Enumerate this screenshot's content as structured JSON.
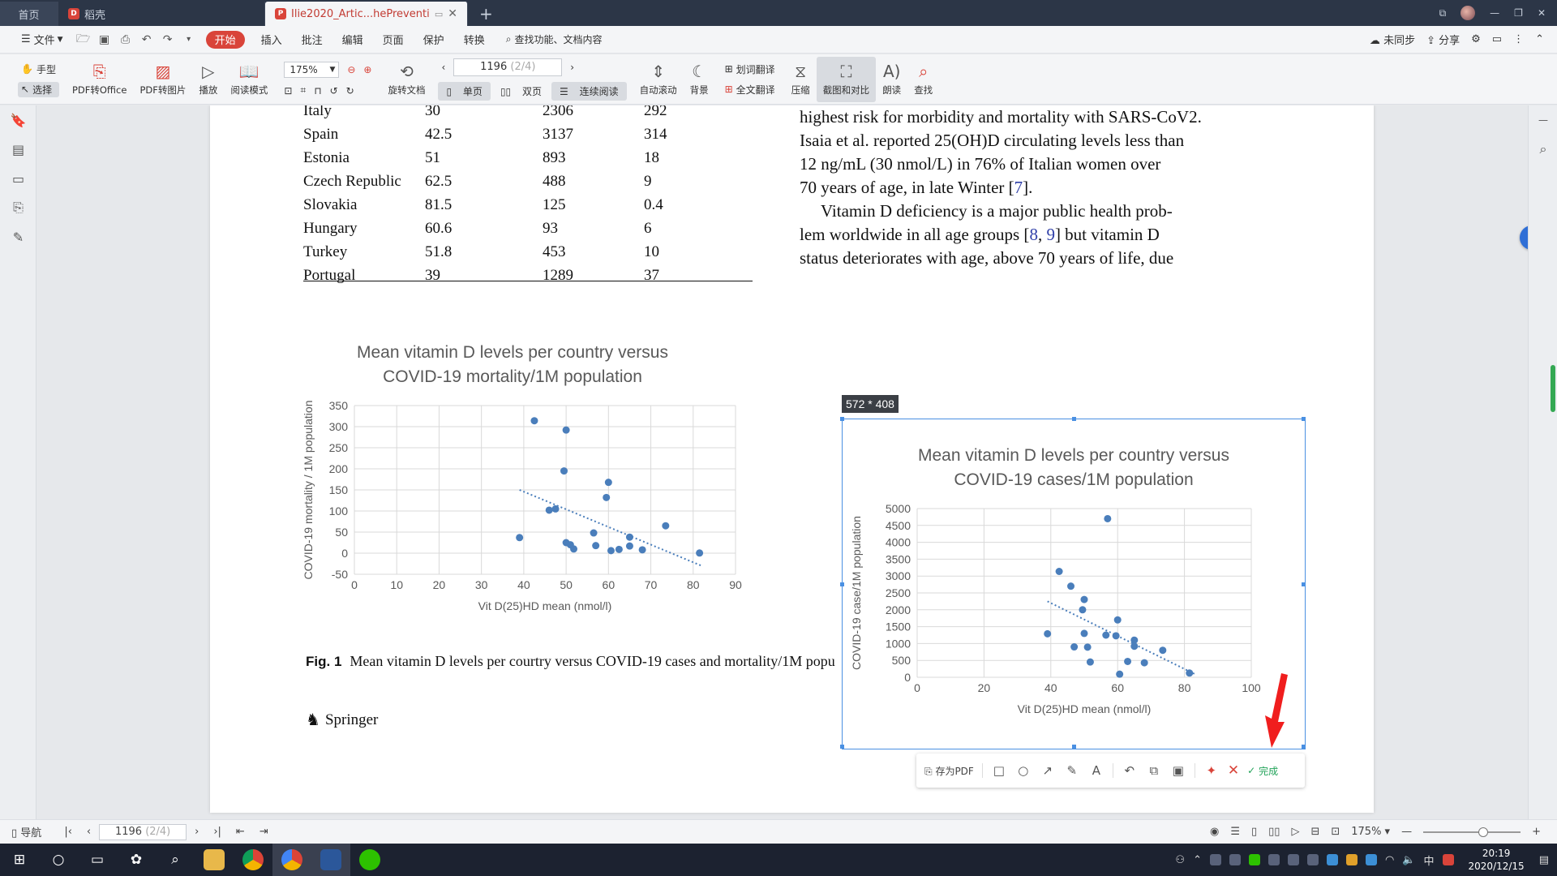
{
  "tabs": {
    "home": "首页",
    "daoke": "稻壳",
    "active": "Ilie2020_Artic...hePreventi.pdf"
  },
  "menu": {
    "file": "文件",
    "start": "开始",
    "items": [
      "插入",
      "批注",
      "编辑",
      "页面",
      "保护",
      "转换"
    ],
    "search": "查找功能、文档内容",
    "sync": "未同步",
    "share": "分享"
  },
  "toolbar": {
    "hand": "手型",
    "select": "选择",
    "pdf_to_office": "PDF转Office",
    "pdf_to_image": "PDF转图片",
    "play": "播放",
    "read_mode": "阅读模式",
    "zoom": "175%",
    "rotate": "旋转文档",
    "page_current": "1196",
    "page_total": "(2/4)",
    "single": "单页",
    "double": "双页",
    "continuous": "连续阅读",
    "autoscroll": "自动滚动",
    "background": "背景",
    "word_translate": "划词翻译",
    "full_translate": "全文翻译",
    "compress": "压缩",
    "screenshot_compare": "截图和对比",
    "read_aloud": "朗读",
    "find": "查找"
  },
  "table_rows": [
    [
      "Italy",
      "30",
      "2306",
      "292"
    ],
    [
      "Spain",
      "42.5",
      "3137",
      "314"
    ],
    [
      "Estonia",
      "51",
      "893",
      "18"
    ],
    [
      "Czech Republic",
      "62.5",
      "488",
      "9"
    ],
    [
      "Slovakia",
      "81.5",
      "125",
      "0.4"
    ],
    [
      "Hungary",
      "60.6",
      "93",
      "6"
    ],
    [
      "Turkey",
      "51.8",
      "453",
      "10"
    ],
    [
      "Portugal",
      "39",
      "1289",
      "37"
    ]
  ],
  "body": {
    "p1_l1": "highest risk for morbidity and mortality with SARS-CoV2.",
    "p1_l2": "Isaia et al. reported 25(OH)D circulating levels less than",
    "p1_l3": "12 ng/mL (30 nmol/L) in 76% of Italian women over",
    "p1_l4a": "70 years of age, in late Winter [",
    "ref7": "7",
    "p1_l4b": "].",
    "p2_l1": "Vitamin D deficiency is a major public health prob-",
    "p2_l2a": "lem worldwide in all age groups [",
    "ref8": "8",
    "comma": ", ",
    "ref9": "9",
    "p2_l2b": "] but vitamin D",
    "p2_l3": "status deteriorates with age, above 70 years of life, due"
  },
  "chart_data": [
    {
      "type": "scatter",
      "title": "Mean vitamin D  levels per country versus COVID-19 mortality/1M population",
      "title_l1": "Mean vitamin D  levels per country versus",
      "title_l2": "COVID-19 mortality/1M population",
      "xlabel": "Vit D(25)HD mean (nmol/l)",
      "ylabel": "COVID-19 mortality / 1M population",
      "xlim": [
        0,
        90
      ],
      "ylim": [
        -50,
        350
      ],
      "xticks": [
        "0",
        "10",
        "20",
        "30",
        "40",
        "50",
        "60",
        "70",
        "80",
        "90"
      ],
      "yticks": [
        "-50",
        "0",
        "50",
        "100",
        "150",
        "200",
        "250",
        "300",
        "350"
      ],
      "grid": true,
      "trendline": {
        "x1": 39,
        "y1": 150,
        "x2": 82,
        "y2": -30
      },
      "points": [
        [
          42.5,
          314
        ],
        [
          50,
          292
        ],
        [
          49.5,
          195
        ],
        [
          60,
          168
        ],
        [
          59.5,
          132
        ],
        [
          46,
          102
        ],
        [
          47.5,
          105
        ],
        [
          39,
          37
        ],
        [
          56.5,
          48
        ],
        [
          73.5,
          65
        ],
        [
          65,
          38
        ],
        [
          50,
          25
        ],
        [
          51,
          20
        ],
        [
          51.8,
          10
        ],
        [
          57,
          18
        ],
        [
          60.6,
          6
        ],
        [
          62.5,
          9
        ],
        [
          65,
          17
        ],
        [
          68,
          8
        ],
        [
          81.5,
          0.4
        ]
      ]
    },
    {
      "type": "scatter",
      "title": "Mean vitamin D  levels per country versus COVID-19 cases/1M population",
      "title_l1": "Mean vitamin D  levels per country versus",
      "title_l2": "COVID-19 cases/1M population",
      "xlabel": "Vit D(25)HD mean (nmol/l)",
      "ylabel": "COVID-19 case/1M population",
      "xlim": [
        0,
        100
      ],
      "ylim": [
        0,
        5000
      ],
      "xticks": [
        "0",
        "20",
        "40",
        "60",
        "80",
        "100"
      ],
      "yticks": [
        "0",
        "500",
        "1000",
        "1500",
        "2000",
        "2500",
        "3000",
        "3500",
        "4000",
        "4500",
        "5000"
      ],
      "grid": true,
      "trendline": {
        "x1": 39,
        "y1": 2250,
        "x2": 83,
        "y2": 100
      },
      "points": [
        [
          57,
          4700
        ],
        [
          42.5,
          3137
        ],
        [
          46,
          2700
        ],
        [
          50,
          2306
        ],
        [
          49.5,
          2000
        ],
        [
          60,
          1700
        ],
        [
          39,
          1289
        ],
        [
          50,
          1300
        ],
        [
          56.5,
          1250
        ],
        [
          59.5,
          1230
        ],
        [
          65,
          1100
        ],
        [
          65,
          920
        ],
        [
          47,
          900
        ],
        [
          51,
          893
        ],
        [
          73.5,
          800
        ],
        [
          51.8,
          453
        ],
        [
          63,
          470
        ],
        [
          68,
          430
        ],
        [
          60.6,
          93
        ],
        [
          81.5,
          125
        ]
      ]
    }
  ],
  "caption": {
    "label": "Fig. 1",
    "text": "Mean vitamin D levels per courtry versus COVID-19 cases and mortality/1M popu"
  },
  "publisher": "Springer",
  "capture": {
    "size": "572 * 408",
    "save_pdf": "存为PDF",
    "done": "完成"
  },
  "status": {
    "nav": "导航",
    "page_current": "1196",
    "page_total": "(2/4)",
    "zoom": "175%"
  },
  "clock": {
    "time": "20:19",
    "date": "2020/12/15"
  },
  "ime": "中"
}
